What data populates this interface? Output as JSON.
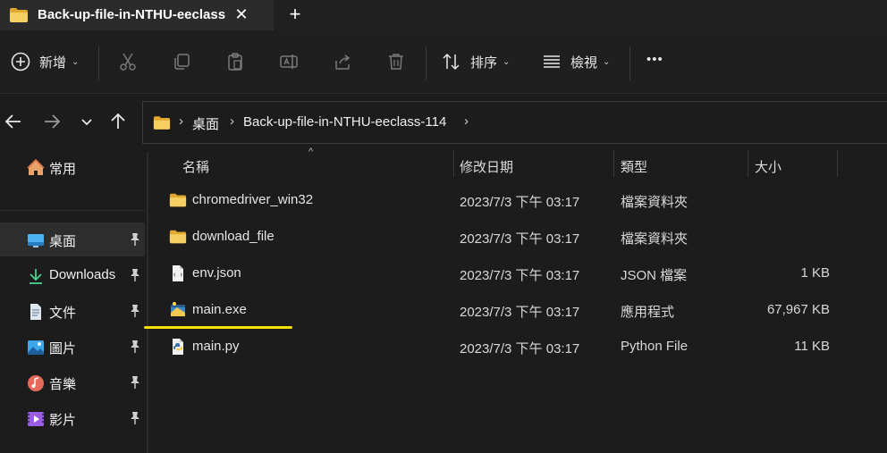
{
  "window": {
    "tab_title": "Back-up-file-in-NTHU-eeclass",
    "close_glyph": "✕",
    "new_tab_glyph": "+"
  },
  "toolbar": {
    "new_label": "新增",
    "sort_label": "排序",
    "view_label": "檢視",
    "more_glyph": "•••",
    "chevron": "⌄"
  },
  "nav": {
    "breadcrumb": [
      "桌面",
      "Back-up-file-in-NTHU-eeclass-114"
    ],
    "crumb_sep": "›"
  },
  "sidebar": {
    "items": [
      {
        "label": "常用",
        "icon": "home-icon",
        "pinned": false
      },
      {
        "label": "桌面",
        "icon": "desktop-icon",
        "pinned": true,
        "active": true
      },
      {
        "label": "Downloads",
        "icon": "download-icon",
        "pinned": true
      },
      {
        "label": "文件",
        "icon": "document-icon",
        "pinned": true
      },
      {
        "label": "圖片",
        "icon": "pictures-icon",
        "pinned": true
      },
      {
        "label": "音樂",
        "icon": "music-icon",
        "pinned": true
      },
      {
        "label": "影片",
        "icon": "videos-icon",
        "pinned": true
      }
    ]
  },
  "list": {
    "columns": {
      "name": "名稱",
      "date": "修改日期",
      "type": "類型",
      "size": "大小"
    },
    "sort_caret": "^",
    "rows": [
      {
        "name": "chromedriver_win32",
        "date": "2023/7/3 下午 03:17",
        "type": "檔案資料夾",
        "size": "",
        "icon": "folder-icon"
      },
      {
        "name": "download_file",
        "date": "2023/7/3 下午 03:17",
        "type": "檔案資料夾",
        "size": "",
        "icon": "folder-icon"
      },
      {
        "name": "env.json",
        "date": "2023/7/3 下午 03:17",
        "type": "JSON 檔案",
        "size": "1 KB",
        "icon": "json-file-icon"
      },
      {
        "name": "main.exe",
        "date": "2023/7/3 下午 03:17",
        "type": "應用程式",
        "size": "67,967 KB",
        "icon": "exe-file-icon"
      },
      {
        "name": "main.py",
        "date": "2023/7/3 下午 03:17",
        "type": "Python File",
        "size": "11 KB",
        "icon": "python-file-icon"
      }
    ]
  },
  "colors": {
    "background": "#1c1c1c",
    "folder": "#f2c55c",
    "highlight": "#f4e000"
  }
}
